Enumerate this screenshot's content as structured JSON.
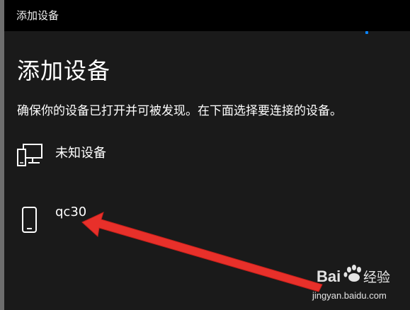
{
  "window": {
    "title": "添加设备"
  },
  "page": {
    "heading": "添加设备",
    "instruction": "确保你的设备已打开并可被发现。在下面选择要连接的设备。"
  },
  "devices": [
    {
      "name": "未知设备",
      "icon": "unknown-device-icon"
    },
    {
      "name": "qc30",
      "icon": "phone-icon"
    }
  ],
  "colors": {
    "background": "#1a1a1a",
    "titlebar": "#000000",
    "text": "#ffffff",
    "annotation_arrow": "#e8302a",
    "focus_dot": "#0a84ff"
  },
  "watermark": {
    "brand": "Bai经验",
    "url": "jingyan.baidu.com"
  }
}
